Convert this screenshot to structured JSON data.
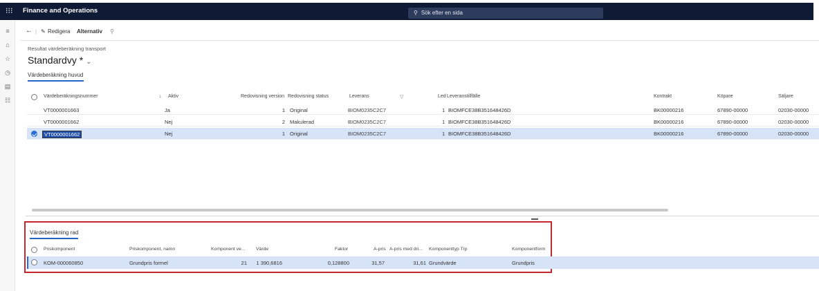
{
  "app": {
    "title": "Finance and Operations"
  },
  "search": {
    "text": "Sök efter en sida"
  },
  "toolbar": {
    "edit_label": "Redigera",
    "options_label": "Alternativ"
  },
  "breadcrumb": "Resultat värdeberäkning transport",
  "view": {
    "title": "Standardvy *"
  },
  "header_tab": "Värdeberäkning huvud",
  "grid_header": {
    "nummer": "Värdeberäkningsnummer",
    "aktiv": "Aktiv",
    "version": "Redovisning version",
    "status": "Redovisning status",
    "leverans": "Leverans",
    "led": "Led",
    "tillfalle": "Leveranstillfälle",
    "kontrakt": "Kontrakt",
    "kopare": "Köpare",
    "saljare": "Säljare"
  },
  "grid_rows": [
    {
      "nummer": "VT0000001663",
      "aktiv": "Ja",
      "version": "1",
      "status": "Original",
      "leverans": "BIOM0235C2C7",
      "led": "1",
      "tillfalle": "BIOMFCE38B351648426D",
      "kontrakt": "BK00000216",
      "kopare": "67890-00000",
      "saljare": "02030-00000"
    },
    {
      "nummer": "VT0000001662",
      "aktiv": "Nej",
      "version": "2",
      "status": "Makulerad",
      "leverans": "BIOM0235C2C7",
      "led": "1",
      "tillfalle": "BIOMFCE38B351648426D",
      "kontrakt": "BK00000216",
      "kopare": "67890-00000",
      "saljare": "02030-00000"
    },
    {
      "nummer": "VT0000001662",
      "aktiv": "Nej",
      "version": "1",
      "status": "Original",
      "leverans": "BIOM0235C2C7",
      "led": "1",
      "tillfalle": "BIOMFCE38B351648426D",
      "kontrakt": "BK00000216",
      "kopare": "67890-00000",
      "saljare": "02030-00000"
    }
  ],
  "lines_tab": "Värdeberäkning rad",
  "lines_header": {
    "komp": "Priskomponent",
    "namn": "Priskomponent, namn",
    "ve": "Komponent ve...",
    "varde": "Värde",
    "faktor": "Faktor",
    "apris": "A-pris",
    "apris_dri": "A-pris med dri...",
    "typ": "Komponenttyp Trp",
    "form": "Komponentform"
  },
  "lines_rows": [
    {
      "komp": "KOM-000060850",
      "namn": "Grundpris formel",
      "ve": "21",
      "varde": "1 390,6816",
      "faktor": "0,128800",
      "apris": "31,57",
      "apris_dri": "31,61",
      "typ": "Grundvärde",
      "form": "Grundpris"
    }
  ],
  "colors": {
    "topbar": "#0f1a35",
    "accent": "#2266c8",
    "selection": "#d7e3f6",
    "highlight_border": "#c4262e"
  }
}
